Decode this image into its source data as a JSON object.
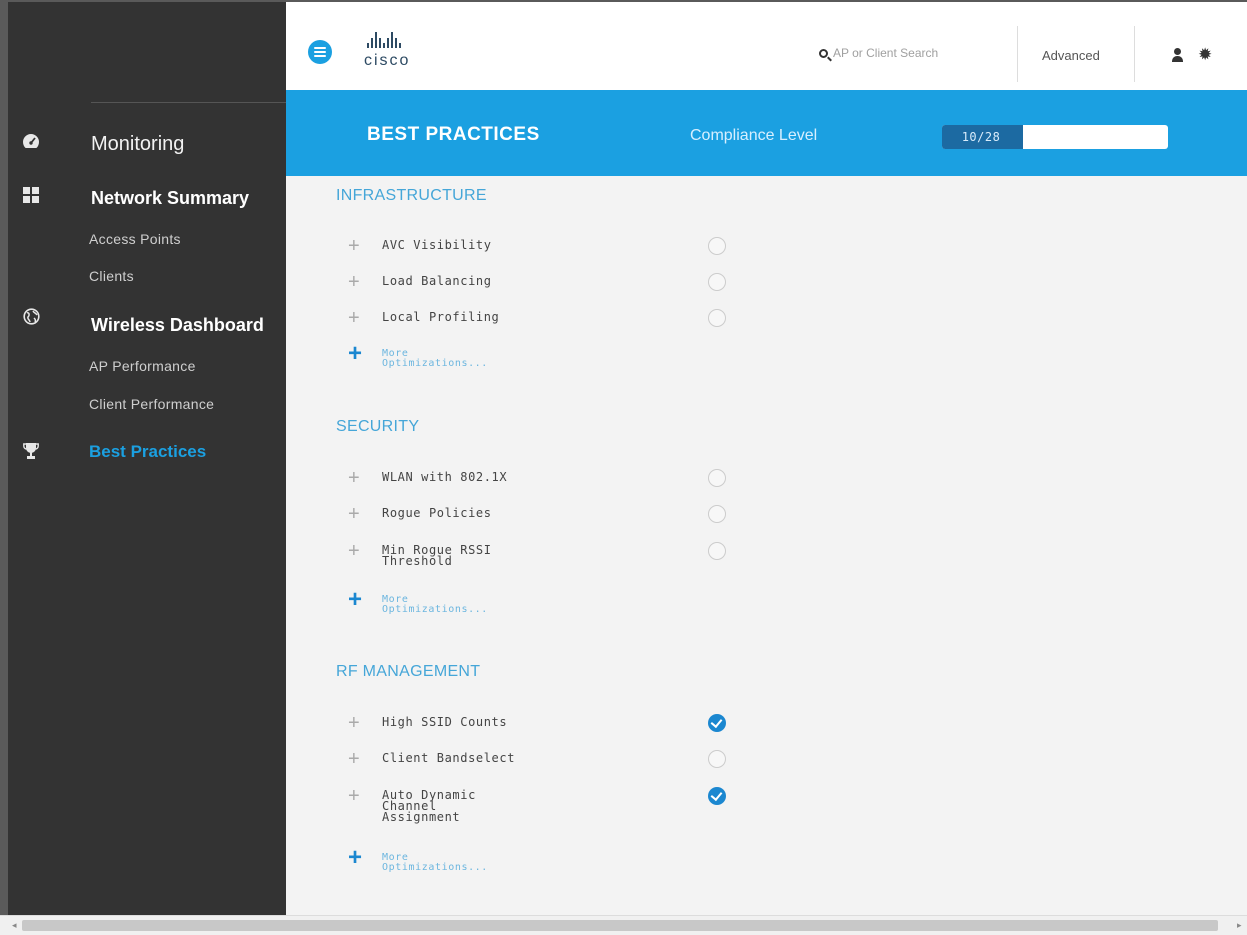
{
  "header": {
    "logo_text": "cisco",
    "search_placeholder": "AP or Client Search",
    "advanced_label": "Advanced"
  },
  "sidebar": {
    "monitoring": "Monitoring",
    "network_summary": "Network Summary",
    "access_points": "Access Points",
    "clients": "Clients",
    "wireless_dashboard": "Wireless Dashboard",
    "ap_performance": "AP Performance",
    "client_performance": "Client Performance",
    "best_practices": "Best Practices"
  },
  "banner": {
    "title": "BEST PRACTICES",
    "compliance_label": "Compliance Level",
    "compliance_text": "10/28",
    "compliance_fraction": 0.357
  },
  "sections": {
    "infrastructure": {
      "title": "INFRASTRUCTURE",
      "items": [
        {
          "label": "AVC Visibility",
          "checked": false
        },
        {
          "label": "Load Balancing",
          "checked": false
        },
        {
          "label": "Local Profiling",
          "checked": false
        }
      ],
      "more": "More Optimizations..."
    },
    "security": {
      "title": "SECURITY",
      "items": [
        {
          "label": "WLAN with 802.1X",
          "checked": false
        },
        {
          "label": "Rogue Policies",
          "checked": false
        },
        {
          "label": "Min Rogue RSSI Threshold",
          "checked": false
        }
      ],
      "more": "More Optimizations..."
    },
    "rf_management": {
      "title": "RF MANAGEMENT",
      "items": [
        {
          "label": "High SSID Counts",
          "checked": true
        },
        {
          "label": "Client Bandselect",
          "checked": false
        },
        {
          "label": "Auto Dynamic Channel Assignment",
          "checked": true
        }
      ],
      "more": "More Optimizations..."
    }
  },
  "colors": {
    "accent": "#1ba0e1",
    "sidebar_bg": "#333333",
    "check_on": "#1b87d0",
    "meter_fill": "#1c6aa2"
  }
}
